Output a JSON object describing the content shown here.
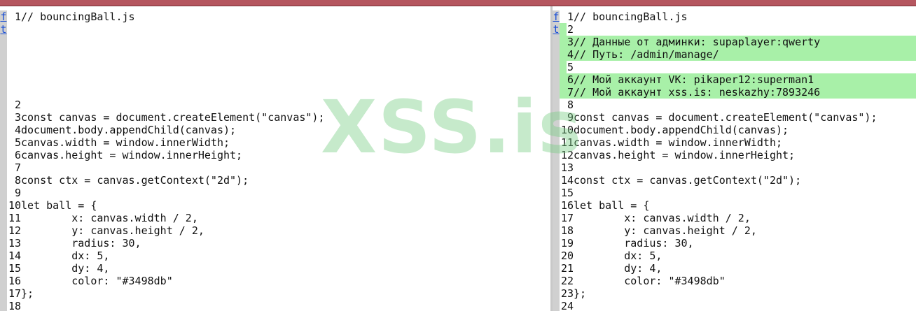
{
  "colors": {
    "topbar": "#b5565f",
    "added_line": "#a8f0a8",
    "fold_link": "#1a4fd6",
    "watermark": "#78cd82"
  },
  "watermark": "XSS.is",
  "fold_links": [
    "f",
    "t"
  ],
  "left": {
    "lines": [
      {
        "n": "1",
        "text": "// bouncingBall.js",
        "gap_after": 6
      },
      {
        "n": "2",
        "text": ""
      },
      {
        "n": "3",
        "text": "const canvas = document.createElement(\"canvas\");"
      },
      {
        "n": "4",
        "text": "document.body.appendChild(canvas);"
      },
      {
        "n": "5",
        "text": "canvas.width = window.innerWidth;"
      },
      {
        "n": "6",
        "text": "canvas.height = window.innerHeight;"
      },
      {
        "n": "7",
        "text": ""
      },
      {
        "n": "8",
        "text": "const ctx = canvas.getContext(\"2d\");"
      },
      {
        "n": "9",
        "text": ""
      },
      {
        "n": "10",
        "text": "let ball = {"
      },
      {
        "n": "11",
        "text": "        x: canvas.width / 2,"
      },
      {
        "n": "12",
        "text": "        y: canvas.height / 2,"
      },
      {
        "n": "13",
        "text": "        radius: 30,"
      },
      {
        "n": "14",
        "text": "        dx: 5,"
      },
      {
        "n": "15",
        "text": "        dy: 4,"
      },
      {
        "n": "16",
        "text": "        color: \"#3498db\""
      },
      {
        "n": "17",
        "text": "};"
      },
      {
        "n": "18",
        "text": ""
      }
    ]
  },
  "right": {
    "lines": [
      {
        "n": "1",
        "text": "// bouncingBall.js"
      },
      {
        "n": "2",
        "text": "",
        "added": "short"
      },
      {
        "n": "3",
        "text": "// Данные от админки: supaplayer:qwerty",
        "added": "full"
      },
      {
        "n": "4",
        "text": "// Путь: /admin/manage/",
        "added": "full"
      },
      {
        "n": "5",
        "text": "",
        "added": "short"
      },
      {
        "n": "6",
        "text": "// Мой аккаунт VK: pikaper12:superman1",
        "added": "full"
      },
      {
        "n": "7",
        "text": "// Мой аккаунт xss.is: neskazhy:7893246",
        "added": "full"
      },
      {
        "n": "8",
        "text": ""
      },
      {
        "n": "9",
        "text": "const canvas = document.createElement(\"canvas\");"
      },
      {
        "n": "10",
        "text": "document.body.appendChild(canvas);"
      },
      {
        "n": "11",
        "text": "canvas.width = window.innerWidth;"
      },
      {
        "n": "12",
        "text": "canvas.height = window.innerHeight;"
      },
      {
        "n": "13",
        "text": ""
      },
      {
        "n": "14",
        "text": "const ctx = canvas.getContext(\"2d\");"
      },
      {
        "n": "15",
        "text": ""
      },
      {
        "n": "16",
        "text": "let ball = {"
      },
      {
        "n": "17",
        "text": "        x: canvas.width / 2,"
      },
      {
        "n": "18",
        "text": "        y: canvas.height / 2,"
      },
      {
        "n": "19",
        "text": "        radius: 30,"
      },
      {
        "n": "20",
        "text": "        dx: 5,"
      },
      {
        "n": "21",
        "text": "        dy: 4,"
      },
      {
        "n": "22",
        "text": "        color: \"#3498db\""
      },
      {
        "n": "23",
        "text": "};"
      },
      {
        "n": "24",
        "text": ""
      }
    ]
  }
}
